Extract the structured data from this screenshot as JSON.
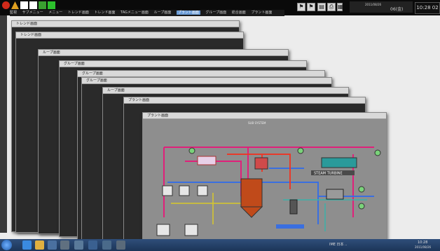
{
  "menu": {
    "items": [
      "監視",
      "サブメニュー",
      "メニュー",
      "トレンド画面",
      "トレンド画面",
      "TAGメニュー画面",
      "ループ画面",
      "プラント画面",
      "グループ画面",
      "総合画面",
      "プラント画面"
    ],
    "active_index": 7
  },
  "clock": {
    "time": "10:28 02",
    "date": "2011/08/26",
    "day": "06(金)"
  },
  "windows": [
    {
      "title": "トレンド画面"
    },
    {
      "title": "トレンド画面"
    },
    {
      "title": "ループ画面"
    },
    {
      "title": "グループ画面"
    },
    {
      "title": "グループ画面"
    },
    {
      "title": "グループ画面"
    },
    {
      "title": "ループ画面"
    },
    {
      "title": "プラント画面"
    },
    {
      "title": "プラント画面"
    }
  ],
  "plant": {
    "label_turbine": "STEAM TURBINE",
    "header": "SUB SYSTEM"
  },
  "taskbar": {
    "tray_text": "IME 日本 ..",
    "time": "10:28",
    "date": "2011/08/26"
  },
  "colors": {
    "pipe_steam": "#e0207a",
    "pipe_water": "#3a6fe0",
    "pipe_hot": "#e83a2a",
    "pipe_gas": "#d8c82a",
    "pipe_air": "#3ab0a8"
  }
}
